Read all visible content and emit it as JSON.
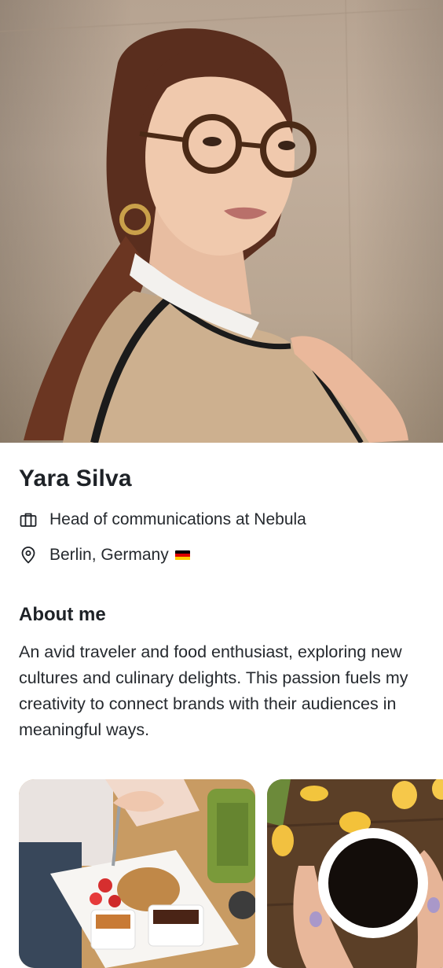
{
  "profile": {
    "name": "Yara Silva",
    "role": "Head of communications at Nebula",
    "location": "Berlin, Germany",
    "flag": "germany-flag-icon"
  },
  "about": {
    "title": "About me",
    "text": "An avid traveler and food enthusiast, exploring new cultures and culinary delights. This passion fuels my creativity to connect brands with their audiences in meaningful ways."
  },
  "icons": {
    "role": "briefcase-icon",
    "location": "location-pin-icon"
  },
  "colors": {
    "text": "#1e2227",
    "flag_black": "#000000",
    "flag_red": "#dd0000",
    "flag_gold": "#ffce00"
  }
}
